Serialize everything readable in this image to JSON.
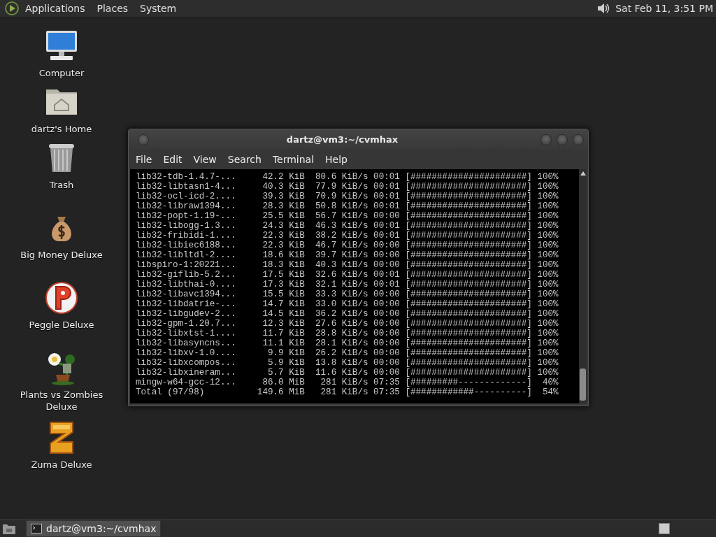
{
  "top_panel": {
    "menus": [
      "Applications",
      "Places",
      "System"
    ],
    "clock": "Sat Feb 11,  3:51 PM"
  },
  "desktop_icons": [
    {
      "label": "Computer",
      "kind": "computer"
    },
    {
      "label": "dartz's Home",
      "kind": "home"
    },
    {
      "label": "Trash",
      "kind": "trash"
    },
    {
      "label": "Big Money Deluxe",
      "kind": "money"
    },
    {
      "label": "Peggle Deluxe",
      "kind": "ball"
    },
    {
      "label": "Plants vs Zombies Deluxe",
      "kind": "plant"
    },
    {
      "label": "Zuma Deluxe",
      "kind": "block"
    }
  ],
  "terminal_window": {
    "title": "dartz@vm3:~/cvmhax",
    "menu": [
      "File",
      "Edit",
      "View",
      "Search",
      "Terminal",
      "Help"
    ],
    "lines": [
      {
        "name": "lib32-tdb-1.4.7-...",
        "size": "42.2 KiB",
        "speed": "80.6 KiB/s",
        "eta": "00:01",
        "bar": "[######################]",
        "percent": "100%"
      },
      {
        "name": "lib32-libtasn1-4...",
        "size": "40.3 KiB",
        "speed": "77.9 KiB/s",
        "eta": "00:01",
        "bar": "[######################]",
        "percent": "100%"
      },
      {
        "name": "lib32-ocl-icd-2....",
        "size": "39.3 KiB",
        "speed": "70.9 KiB/s",
        "eta": "00:01",
        "bar": "[######################]",
        "percent": "100%"
      },
      {
        "name": "lib32-libraw1394...",
        "size": "28.3 KiB",
        "speed": "50.8 KiB/s",
        "eta": "00:01",
        "bar": "[######################]",
        "percent": "100%"
      },
      {
        "name": "lib32-popt-1.19-...",
        "size": "25.5 KiB",
        "speed": "56.7 KiB/s",
        "eta": "00:00",
        "bar": "[######################]",
        "percent": "100%"
      },
      {
        "name": "lib32-libogg-1.3...",
        "size": "24.3 KiB",
        "speed": "46.3 KiB/s",
        "eta": "00:01",
        "bar": "[######################]",
        "percent": "100%"
      },
      {
        "name": "lib32-fribidi-1....",
        "size": "22.3 KiB",
        "speed": "38.2 KiB/s",
        "eta": "00:01",
        "bar": "[######################]",
        "percent": "100%"
      },
      {
        "name": "lib32-libiec6188...",
        "size": "22.3 KiB",
        "speed": "46.7 KiB/s",
        "eta": "00:00",
        "bar": "[######################]",
        "percent": "100%"
      },
      {
        "name": "lib32-libltdl-2....",
        "size": "18.6 KiB",
        "speed": "39.7 KiB/s",
        "eta": "00:00",
        "bar": "[######################]",
        "percent": "100%"
      },
      {
        "name": "libspiro-1:20221...",
        "size": "18.3 KiB",
        "speed": "40.3 KiB/s",
        "eta": "00:00",
        "bar": "[######################]",
        "percent": "100%"
      },
      {
        "name": "lib32-giflib-5.2...",
        "size": "17.5 KiB",
        "speed": "32.6 KiB/s",
        "eta": "00:01",
        "bar": "[######################]",
        "percent": "100%"
      },
      {
        "name": "lib32-libthai-0....",
        "size": "17.3 KiB",
        "speed": "32.1 KiB/s",
        "eta": "00:01",
        "bar": "[######################]",
        "percent": "100%"
      },
      {
        "name": "lib32-libavc1394...",
        "size": "15.5 KiB",
        "speed": "33.3 KiB/s",
        "eta": "00:00",
        "bar": "[######################]",
        "percent": "100%"
      },
      {
        "name": "lib32-libdatrie-...",
        "size": "14.7 KiB",
        "speed": "33.0 KiB/s",
        "eta": "00:00",
        "bar": "[######################]",
        "percent": "100%"
      },
      {
        "name": "lib32-libgudev-2...",
        "size": "14.5 KiB",
        "speed": "36.2 KiB/s",
        "eta": "00:00",
        "bar": "[######################]",
        "percent": "100%"
      },
      {
        "name": "lib32-gpm-1.20.7...",
        "size": "12.3 KiB",
        "speed": "27.6 KiB/s",
        "eta": "00:00",
        "bar": "[######################]",
        "percent": "100%"
      },
      {
        "name": "lib32-libxtst-1....",
        "size": "11.7 KiB",
        "speed": "28.8 KiB/s",
        "eta": "00:00",
        "bar": "[######################]",
        "percent": "100%"
      },
      {
        "name": "lib32-libasyncns...",
        "size": "11.1 KiB",
        "speed": "28.1 KiB/s",
        "eta": "00:00",
        "bar": "[######################]",
        "percent": "100%"
      },
      {
        "name": "lib32-libxv-1.0....",
        "size": "9.9 KiB",
        "speed": "26.2 KiB/s",
        "eta": "00:00",
        "bar": "[######################]",
        "percent": "100%"
      },
      {
        "name": "lib32-libxcompos...",
        "size": "5.9 KiB",
        "speed": "13.8 KiB/s",
        "eta": "00:00",
        "bar": "[######################]",
        "percent": "100%"
      },
      {
        "name": "lib32-libxineram...",
        "size": "5.7 KiB",
        "speed": "11.6 KiB/s",
        "eta": "00:00",
        "bar": "[######################]",
        "percent": "100%"
      },
      {
        "name": "mingw-w64-gcc-12...",
        "size": "86.0 MiB",
        "speed": "281 KiB/s",
        "eta": "07:35",
        "bar": "[#########-------------]",
        "percent": "40%"
      },
      {
        "name": "Total (97/98)",
        "size": "149.6 MiB",
        "speed": "281 KiB/s",
        "eta": "07:35",
        "bar": "[############----------]",
        "percent": "54%"
      }
    ]
  },
  "taskbar": {
    "tasks": [
      {
        "label": "dartz@vm3:~/cvmhax",
        "selected": true
      }
    ]
  }
}
